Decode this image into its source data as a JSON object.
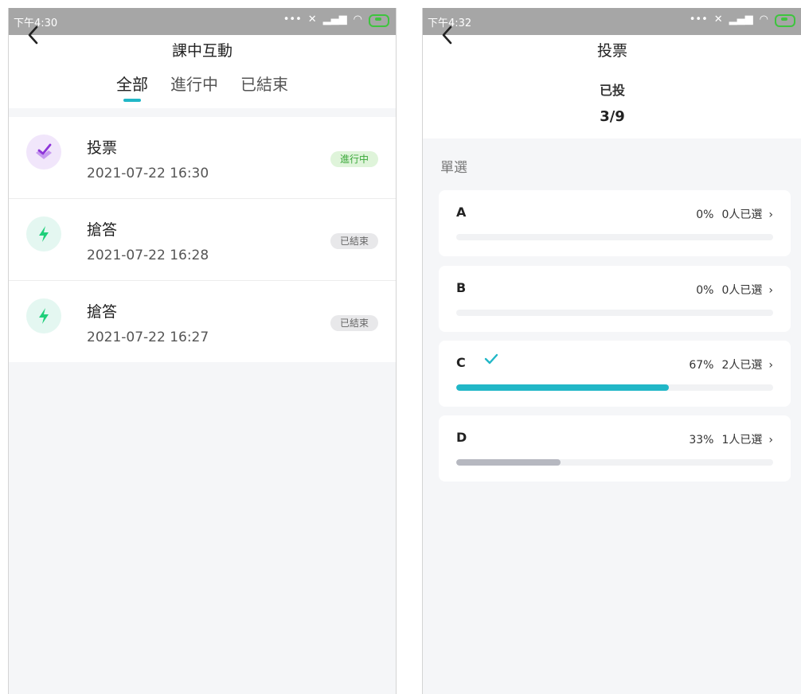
{
  "left": {
    "status": {
      "time": "下午4:30"
    },
    "title": "課中互動",
    "tabs": [
      {
        "label": "全部",
        "active": true
      },
      {
        "label": "進行中",
        "active": false
      },
      {
        "label": "已結束",
        "active": false
      }
    ],
    "items": [
      {
        "title": "投票",
        "time": "2021-07-22 16:30",
        "badge": "進行中",
        "icon": "vote-icon"
      },
      {
        "title": "搶答",
        "time": "2021-07-22 16:28",
        "badge": "已結束",
        "icon": "lightning-icon"
      },
      {
        "title": "搶答",
        "time": "2021-07-22 16:27",
        "badge": "已結束",
        "icon": "lightning-icon"
      }
    ]
  },
  "right": {
    "status": {
      "time": "下午4:32"
    },
    "title": "投票",
    "voted_label": "已投",
    "voted_count": "3/9",
    "section_label": "單選",
    "options": [
      {
        "letter": "A",
        "percent_text": "0%",
        "count_text": "0人已選",
        "fraction": 0,
        "correct": false
      },
      {
        "letter": "B",
        "percent_text": "0%",
        "count_text": "0人已選",
        "fraction": 0,
        "correct": false
      },
      {
        "letter": "C",
        "percent_text": "67%",
        "count_text": "2人已選",
        "fraction": 0.67,
        "correct": true
      },
      {
        "letter": "D",
        "percent_text": "33%",
        "count_text": "1人已選",
        "fraction": 0.33,
        "correct": false
      }
    ]
  },
  "colors": {
    "accent": "#21b7c7",
    "purple": "#9b3ee0",
    "purple_bg": "#f1e6fb",
    "green": "#1fcf7a",
    "green_bg": "#e4f7f1",
    "badge_active_bg": "#dff4da",
    "badge_active_text": "#3aa83a",
    "badge_done_bg": "#e8e8ea",
    "badge_done_text": "#666666",
    "bar_gray": "#b6b8c0"
  }
}
